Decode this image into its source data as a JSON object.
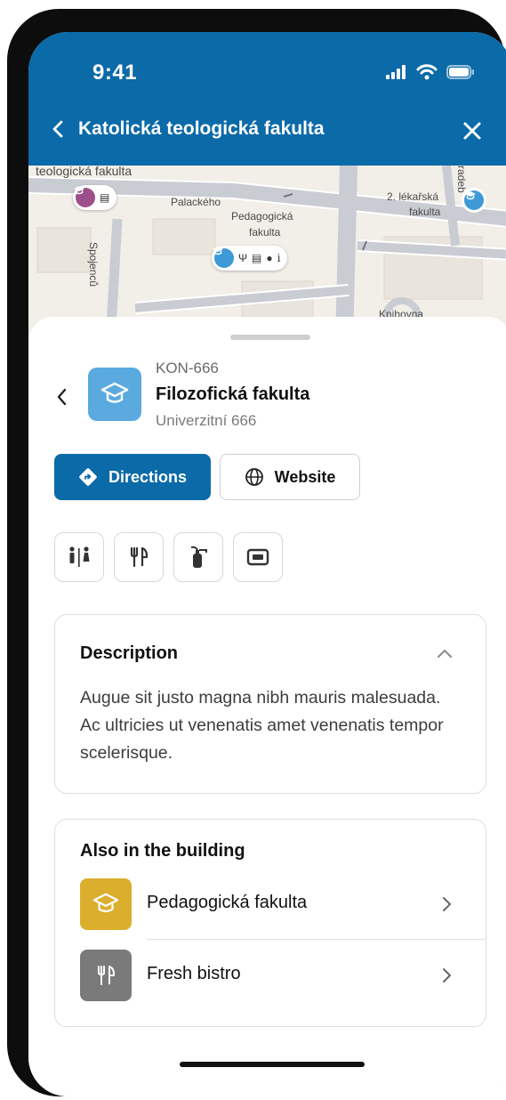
{
  "status_bar": {
    "time": "9:41"
  },
  "header": {
    "title": "Katolická teologická fakulta"
  },
  "map": {
    "labels": {
      "teologicka": "teologická fakulta",
      "palackeho": "Palackého",
      "pedagogicka_line1": "Pedagogická",
      "pedagogicka_line2": "fakulta",
      "spojencu": "Spojenců",
      "lekarska_line1": "2. lékařská",
      "lekarska_line2": "fakulta",
      "knihovna": "Knihovna",
      "radeb": "radeb"
    }
  },
  "poi": {
    "code": "KON-666",
    "name": "Filozofická fakulta",
    "address": "Univerzitní 666",
    "tile_color": "#5aaadf"
  },
  "actions": {
    "directions_label": "Directions",
    "website_label": "Website"
  },
  "amenities": [
    "restroom-icon",
    "restaurant-icon",
    "fire-extinguisher-icon",
    "atm-icon"
  ],
  "description": {
    "title": "Description",
    "text": "Augue sit justo magna nibh mauris malesuada. Ac ultricies ut venenatis amet venenatis tempor scelerisque."
  },
  "also_in_building": {
    "title": "Also in the building",
    "items": [
      {
        "label": "Pedagogická fakulta",
        "icon": "graduation-cap-icon",
        "color": "#dcae2e"
      },
      {
        "label": "Fresh bistro",
        "icon": "fork-knife-icon",
        "color": "#7a7a7a"
      }
    ]
  },
  "colors": {
    "brand": "#0b6aa8",
    "pin_purple": "#9c4f8a",
    "pin_blue": "#3e9ad6"
  }
}
